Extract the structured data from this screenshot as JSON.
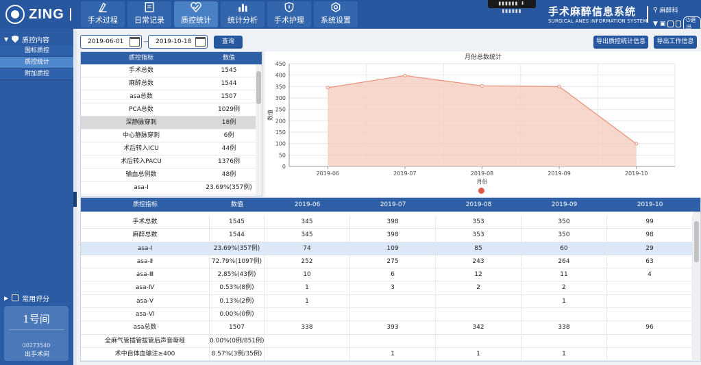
{
  "header": {
    "logo_text": "ZING",
    "system_title": "手术麻醉信息系统",
    "system_subtitle": "SURGICAL ANES INFORMATION SYSTEM",
    "user_name": "麻醉科",
    "logout_label": "退出",
    "nav": [
      {
        "label": "手术过程",
        "icon": "scalpel-icon"
      },
      {
        "label": "日常记录",
        "icon": "notebook-icon"
      },
      {
        "label": "质控统计",
        "icon": "heart-check-icon"
      },
      {
        "label": "统计分析",
        "icon": "bar-chart-icon"
      },
      {
        "label": "手术护理",
        "icon": "shield-icon"
      },
      {
        "label": "系统设置",
        "icon": "gear-icon"
      }
    ],
    "active_nav": "质控统计"
  },
  "sidebar": {
    "section_title": "质控内容",
    "items": [
      {
        "label": "国标质控"
      },
      {
        "label": "质控统计"
      },
      {
        "label": "附加质控"
      }
    ],
    "active_item": "质控统计",
    "common_score_label": "常用评分",
    "room": {
      "name": "1号间",
      "code": "00273540",
      "status": "出手术间"
    }
  },
  "toolbar": {
    "start_date": "2019-06-01",
    "end_date": "2019-10-18",
    "date_separator": "--",
    "query_label": "查询",
    "export_stats_label": "导出质控统计信息",
    "export_work_label": "导出工作信息"
  },
  "summary_table": {
    "headers": [
      "质控指标",
      "数值"
    ],
    "rows": [
      [
        "手术总数",
        "1545"
      ],
      [
        "麻醉总数",
        "1544"
      ],
      [
        "asa总数",
        "1507"
      ],
      [
        "PCA总数",
        "1029例"
      ],
      [
        "深静脉穿刺",
        "18例"
      ],
      [
        "中心静脉穿刺",
        "6例"
      ],
      [
        "术后转入ICU",
        "44例"
      ],
      [
        "术后转入PACU",
        "1376例"
      ],
      [
        "输血总例数",
        "48例"
      ],
      [
        "asa-Ⅰ",
        "23.69%(357例)"
      ]
    ],
    "selected_row": 4
  },
  "chart_data": {
    "type": "area",
    "title": "月份总数统计",
    "xlabel": "月份",
    "ylabel": "数值",
    "categories": [
      "2019-06",
      "2019-07",
      "2019-08",
      "2019-09",
      "2019-10"
    ],
    "series": [
      {
        "values": [
          345,
          398,
          353,
          350,
          99
        ]
      }
    ],
    "ylim": [
      0,
      450
    ],
    "yticks": [
      0,
      50,
      100,
      150,
      200,
      250,
      300,
      350,
      400,
      450
    ],
    "grid": true,
    "line_color": "#e8907a",
    "fill_color": "#f6cfc2"
  },
  "detail_table": {
    "headers": [
      "质控指标",
      "数值",
      "2019-06",
      "2019-07",
      "2019-08",
      "2019-09",
      "2019-10"
    ],
    "rows": [
      [
        "手术总数",
        "1545",
        "345",
        "398",
        "353",
        "350",
        "99"
      ],
      [
        "麻醉总数",
        "1544",
        "345",
        "398",
        "353",
        "350",
        "98"
      ],
      [
        "asa-Ⅰ",
        "23.69%(357例)",
        "74",
        "109",
        "85",
        "60",
        "29"
      ],
      [
        "asa-Ⅱ",
        "72.79%(1097例)",
        "252",
        "275",
        "243",
        "264",
        "63"
      ],
      [
        "asa-Ⅲ",
        "2.85%(43例)",
        "10",
        "6",
        "12",
        "11",
        "4"
      ],
      [
        "asa-Ⅳ",
        "0.53%(8例)",
        "1",
        "3",
        "2",
        "2",
        ""
      ],
      [
        "asa-Ⅴ",
        "0.13%(2例)",
        "1",
        "",
        "",
        "1",
        ""
      ],
      [
        "asa-Ⅵ",
        "0.00%(0例)",
        "",
        "",
        "",
        "",
        ""
      ],
      [
        "asa总数",
        "1507",
        "338",
        "393",
        "342",
        "338",
        "96"
      ],
      [
        "全麻气管插管拔管后声音嘶哑",
        "0.00%(0例/851例)",
        "",
        "",
        "",
        "",
        ""
      ],
      [
        "术中自体血输注≥400",
        "8.57%(3例/35例)",
        "",
        "1",
        "1",
        "1",
        ""
      ]
    ],
    "selected_row": 2
  }
}
